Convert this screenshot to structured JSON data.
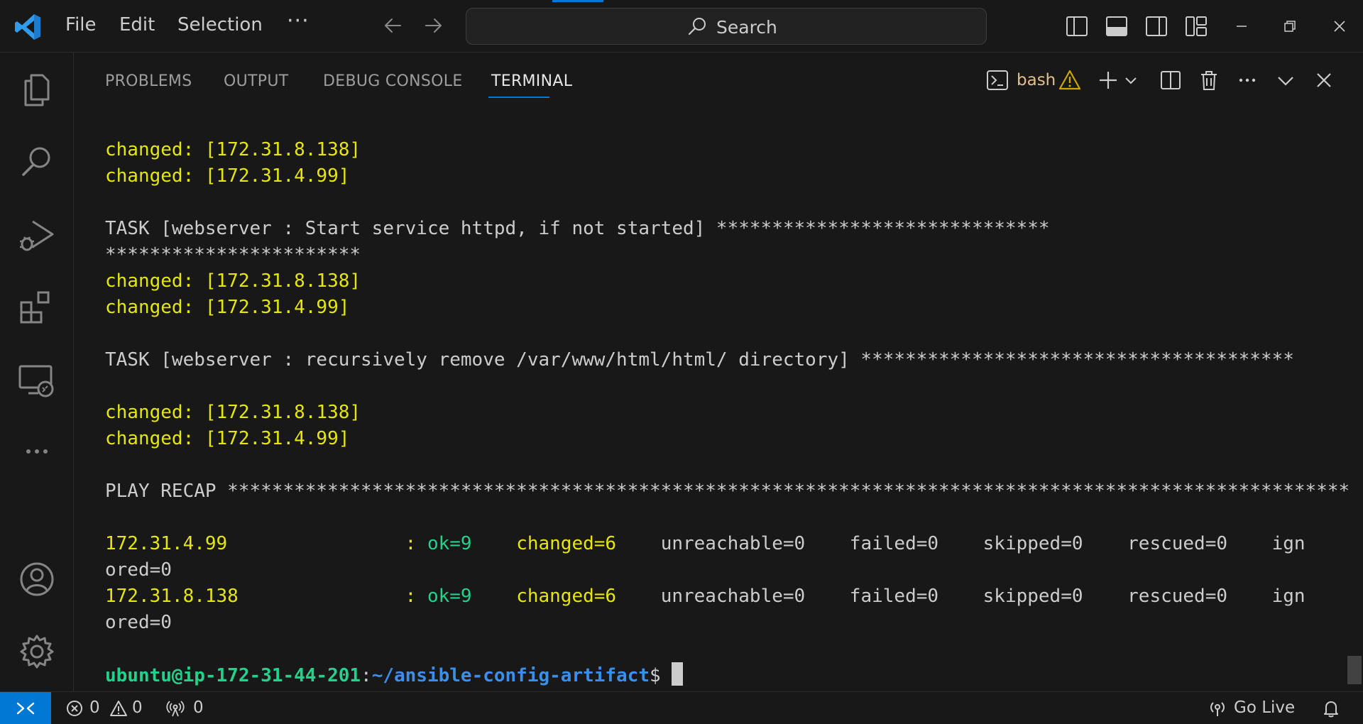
{
  "titlebar": {
    "menu": [
      "File",
      "Edit",
      "Selection",
      "···"
    ],
    "search_label": "Search"
  },
  "panel": {
    "tabs": [
      "PROBLEMS",
      "OUTPUT",
      "DEBUG CONSOLE",
      "TERMINAL"
    ],
    "active_tab": "TERMINAL",
    "terminal_profile": "bash"
  },
  "terminal": {
    "changed_138": "changed: [172.31.8.138]",
    "changed_99": "changed: [172.31.4.99]",
    "task_start_service": "TASK [webserver : Start service httpd, if not started] ******************************",
    "task_start_service_wrap": "***********************",
    "task_remove_dir": "TASK [webserver : recursively remove /var/www/html/html/ directory] ***************************************",
    "play_recap": "PLAY RECAP *****************************************************************************************************",
    "recap": [
      {
        "host": "172.31.4.99                : ",
        "ok": "ok=9",
        "changed": "    changed=6",
        "rest": "    unreachable=0    failed=0    skipped=0    rescued=0    ign",
        "wrap": "ored=0"
      },
      {
        "host": "172.31.8.138               : ",
        "ok": "ok=9",
        "changed": "    changed=6",
        "rest": "    unreachable=0    failed=0    skipped=0    rescued=0    ign",
        "wrap": "ored=0"
      }
    ],
    "prompt_user": "ubuntu@ip-172-31-44-201",
    "prompt_sep": ":",
    "prompt_path": "~/ansible-config-artifact",
    "prompt_symbol": "$ "
  },
  "statusbar": {
    "errors": "0",
    "warnings": "0",
    "ports": "0",
    "go_live": "Go Live"
  },
  "colors": {
    "accent": "#0078d4",
    "changed_yellow": "#e5e510",
    "ok_green": "#23d18b",
    "path_blue": "#3b8eea",
    "bash_gold": "#e2c08d"
  }
}
